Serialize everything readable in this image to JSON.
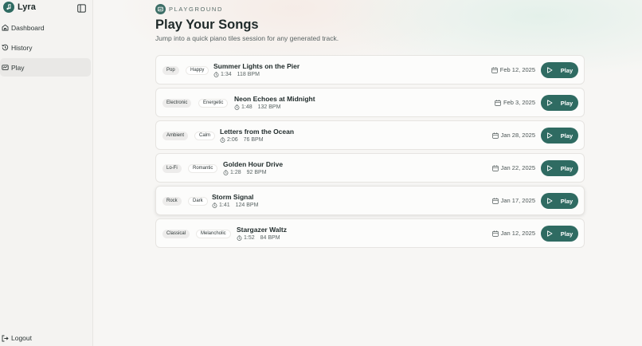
{
  "app": {
    "name": "Lyra"
  },
  "sidebar": {
    "items": [
      {
        "label": "Dashboard",
        "icon": "home-icon"
      },
      {
        "label": "History",
        "icon": "history-icon"
      },
      {
        "label": "Play",
        "icon": "playground-icon",
        "active": true
      }
    ],
    "logout_label": "Logout"
  },
  "header": {
    "eyebrow": "PLAYGROUND",
    "title": "Play Your Songs",
    "subtitle": "Jump into a quick piano tiles session for any generated track."
  },
  "songs": [
    {
      "genre": "Pop",
      "mood": "Happy",
      "title": "Summer Lights on the Pier",
      "duration": "1:34",
      "bpm": "118 BPM",
      "date": "Feb 12, 2025",
      "play_label": "Play"
    },
    {
      "genre": "Electronic",
      "mood": "Energetic",
      "title": "Neon Echoes at Midnight",
      "duration": "1:48",
      "bpm": "132 BPM",
      "date": "Feb 3, 2025",
      "play_label": "Play"
    },
    {
      "genre": "Ambient",
      "mood": "Calm",
      "title": "Letters from the Ocean",
      "duration": "2:06",
      "bpm": "76 BPM",
      "date": "Jan 28, 2025",
      "play_label": "Play"
    },
    {
      "genre": "Lo-Fi",
      "mood": "Romantic",
      "title": "Golden Hour Drive",
      "duration": "1:28",
      "bpm": "92 BPM",
      "date": "Jan 22, 2025",
      "play_label": "Play"
    },
    {
      "genre": "Rock",
      "mood": "Dark",
      "title": "Storm Signal",
      "duration": "1:41",
      "bpm": "124 BPM",
      "date": "Jan 17, 2025",
      "play_label": "Play"
    },
    {
      "genre": "Classical",
      "mood": "Melancholic",
      "title": "Stargazer Waltz",
      "duration": "1:52",
      "bpm": "84 BPM",
      "date": "Jan 12, 2025",
      "play_label": "Play"
    }
  ],
  "colors": {
    "accent": "#2f6b62",
    "background": "#f7f6f4"
  }
}
